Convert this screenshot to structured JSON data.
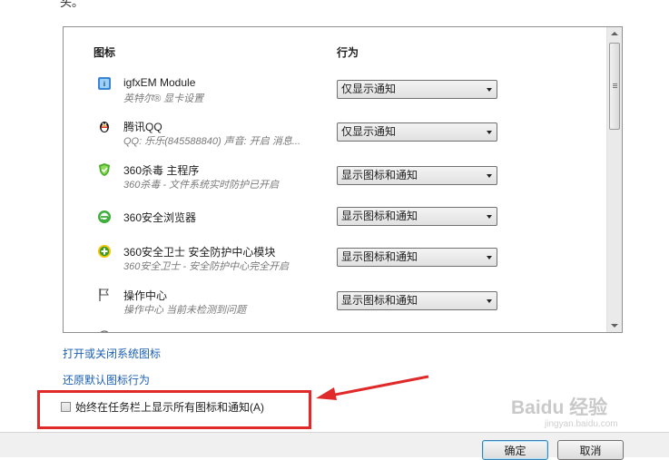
{
  "top_fragment": "头。",
  "table": {
    "header_icon": "图标",
    "header_action": "行为",
    "rows": [
      {
        "name": "igfxEM Module",
        "desc": "英特尔® 显卡设置",
        "action": "仅显示通知",
        "icon": "intel-graphics-icon"
      },
      {
        "name": "腾讯QQ",
        "desc": "QQ: 乐乐(845588840)  声音: 开启  消息...",
        "action": "仅显示通知",
        "icon": "qq-penguin-icon"
      },
      {
        "name": "360杀毒 主程序",
        "desc": "360杀毒 - 文件系统实时防护已开启",
        "action": "显示图标和通知",
        "icon": "360-antivirus-icon"
      },
      {
        "name": "360安全浏览器",
        "desc": "",
        "action": "显示图标和通知",
        "icon": "360-browser-icon"
      },
      {
        "name": "360安全卫士 安全防护中心模块",
        "desc": "360安全卫士 - 安全防护中心完全开启",
        "action": "显示图标和通知",
        "icon": "360-safeguard-icon"
      },
      {
        "name": "操作中心",
        "desc": "操作中心  当前未检测到问题",
        "action": "显示图标和通知",
        "icon": "action-center-flag-icon"
      }
    ]
  },
  "links": {
    "system_icons": "打开或关闭系统图标",
    "restore_default": "还原默认图标行为"
  },
  "checkbox": {
    "label": "始终在任务栏上显示所有图标和通知(A)",
    "checked": false
  },
  "buttons": {
    "ok": "确定",
    "cancel": "取消"
  },
  "watermark": {
    "main": "Baidu 经验",
    "sub": "jingyan.baidu.com"
  },
  "colors": {
    "link": "#1c5fb0",
    "annotation": "#e02a2a"
  }
}
